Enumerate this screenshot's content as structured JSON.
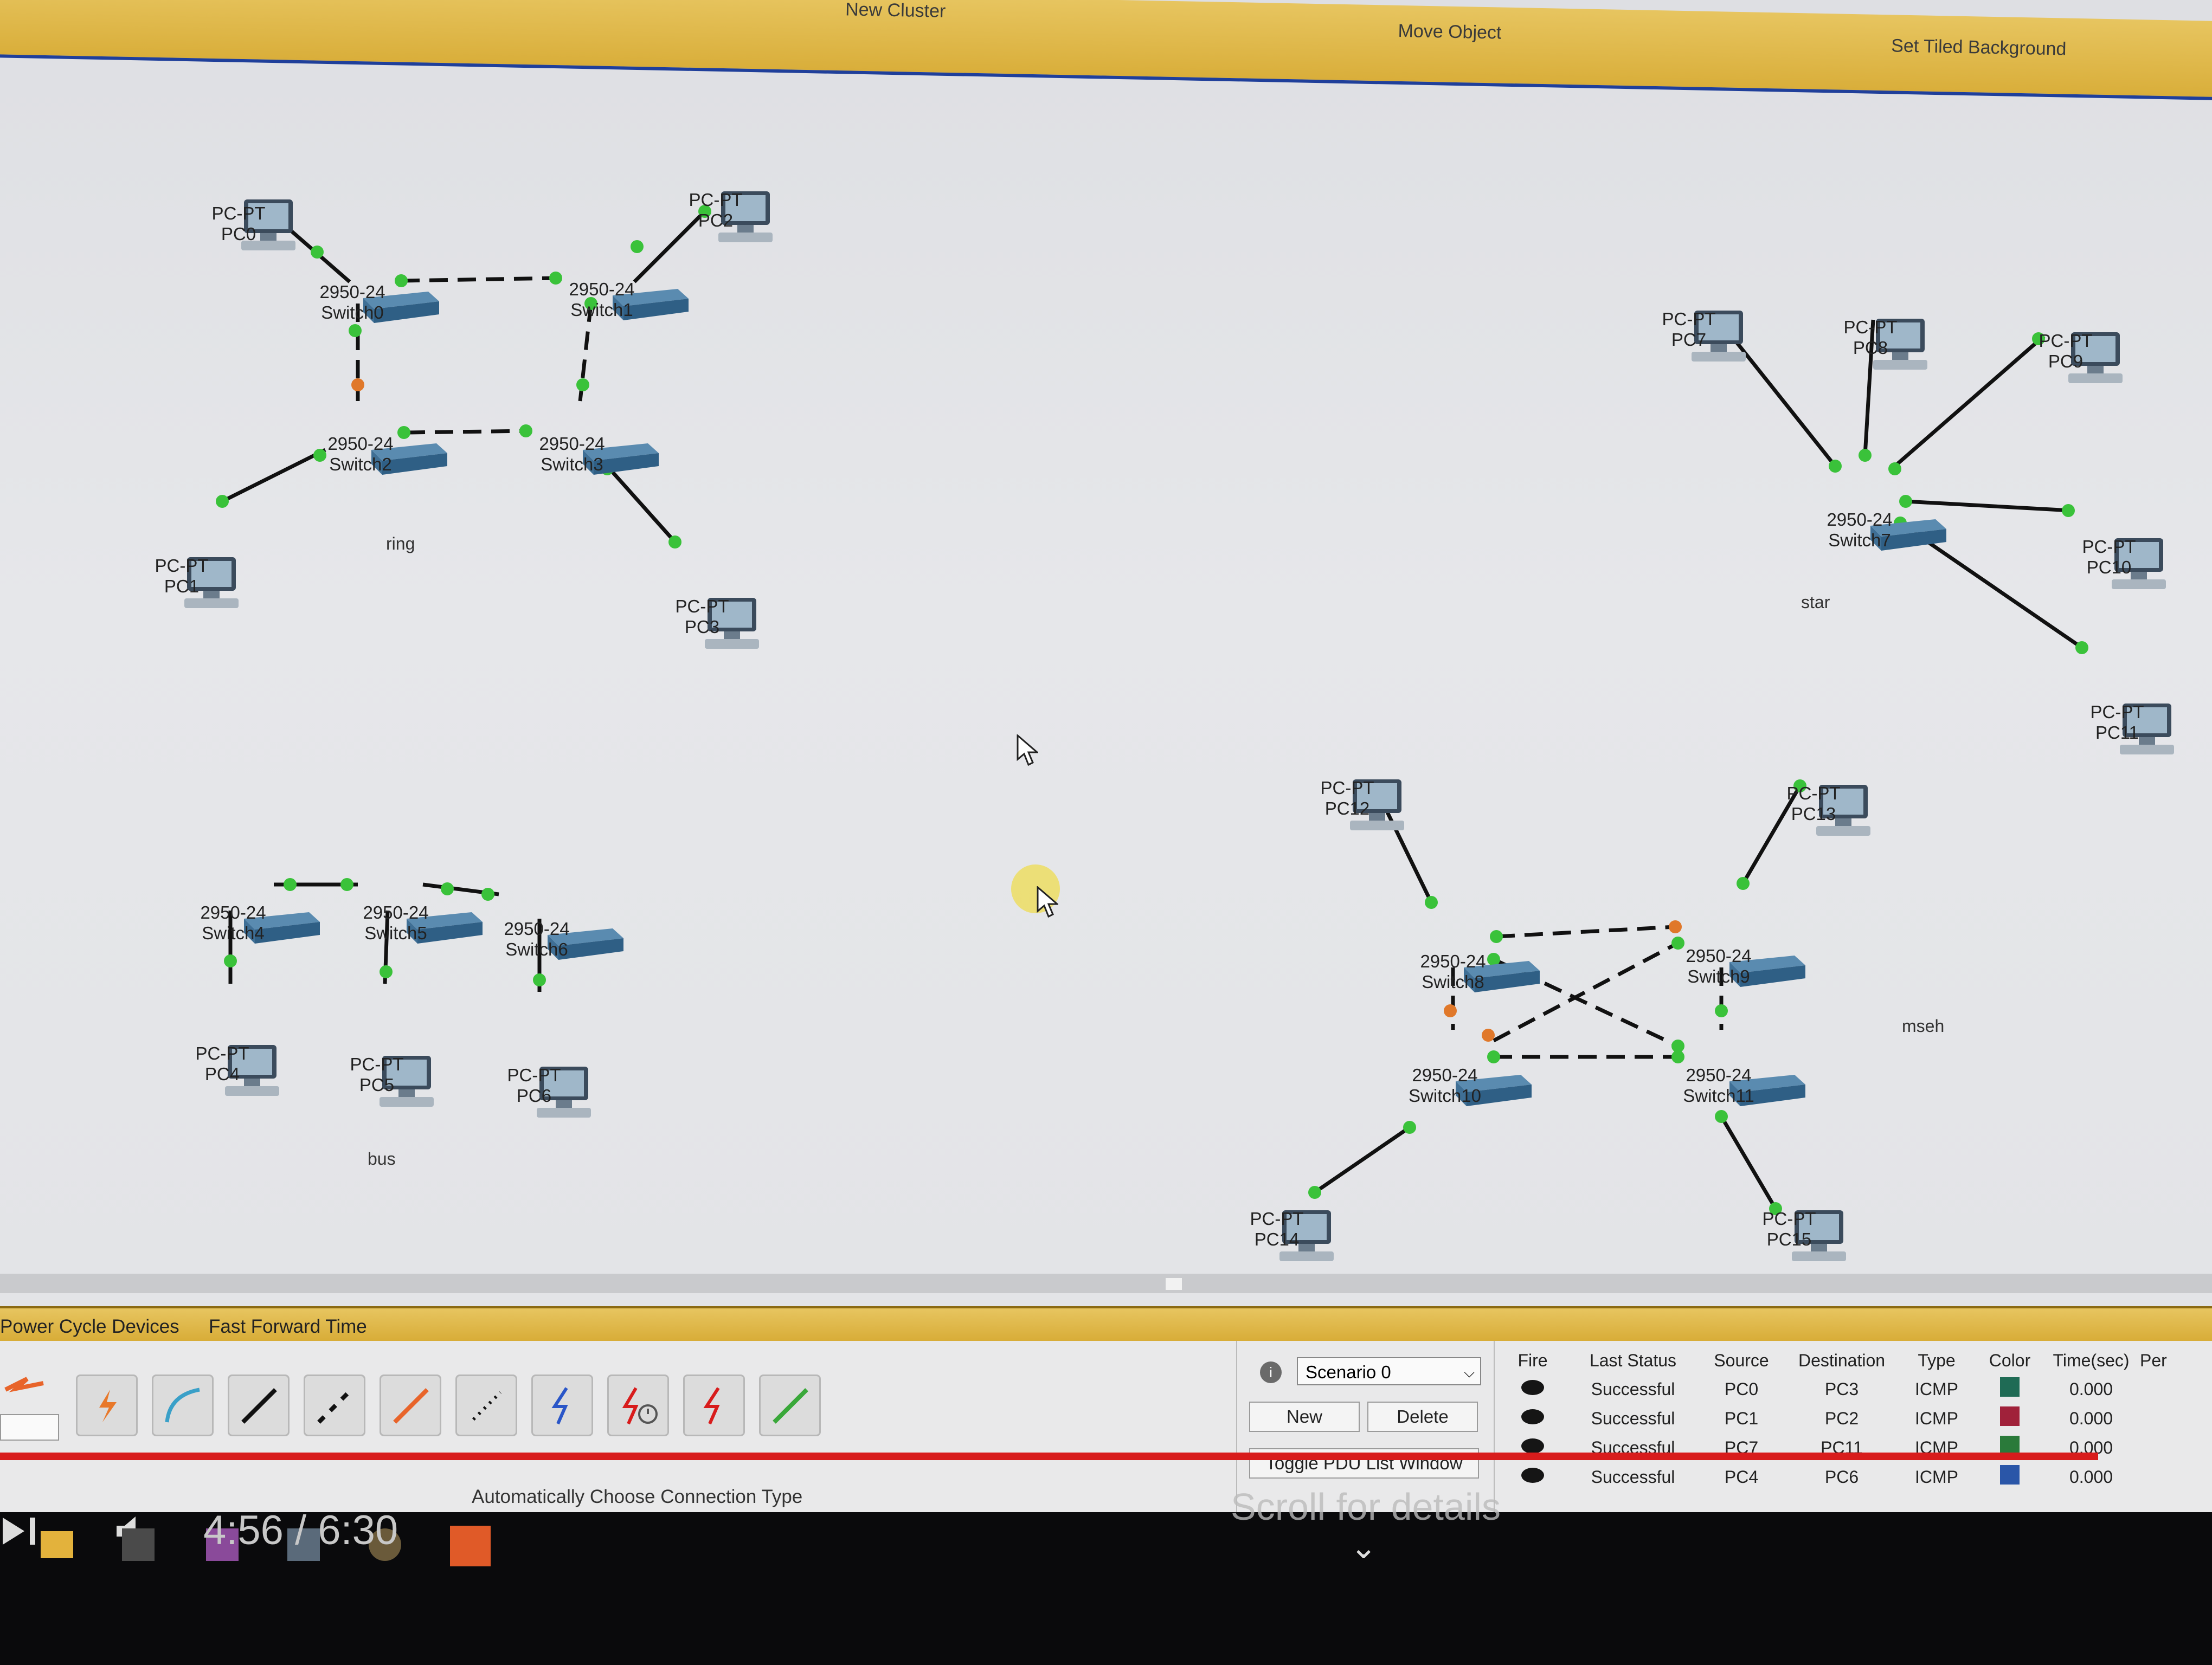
{
  "topbar": {
    "cluster": "New Cluster",
    "move": "Move Object",
    "background": "Set Tiled Background"
  },
  "groups": {
    "ring": "ring",
    "star": "star",
    "bus": "bus",
    "mesh": "mseh"
  },
  "devices": {
    "pc0": {
      "type": "PC-PT",
      "name": "PC0"
    },
    "pc1": {
      "type": "PC-PT",
      "name": "PC1"
    },
    "pc2": {
      "type": "PC-PT",
      "name": "PC2"
    },
    "pc3": {
      "type": "PC-PT",
      "name": "PC3"
    },
    "pc4": {
      "type": "PC-PT",
      "name": "PC4"
    },
    "pc5": {
      "type": "PC-PT",
      "name": "PC5"
    },
    "pc6": {
      "type": "PC-PT",
      "name": "PC6"
    },
    "pc7": {
      "type": "PC-PT",
      "name": "PC7"
    },
    "pc8": {
      "type": "PC-PT",
      "name": "PC8"
    },
    "pc9": {
      "type": "PC-PT",
      "name": "PC9"
    },
    "pc10": {
      "type": "PC-PT",
      "name": "PC10"
    },
    "pc11": {
      "type": "PC-PT",
      "name": "PC11"
    },
    "pc12": {
      "type": "PC-PT",
      "name": "PC12"
    },
    "pc13": {
      "type": "PC-PT",
      "name": "PC13"
    },
    "pc14": {
      "type": "PC-PT",
      "name": "PC14"
    },
    "pc15": {
      "type": "PC-PT",
      "name": "PC15"
    },
    "sw0": {
      "type": "2950-24",
      "name": "Switch0"
    },
    "sw1": {
      "type": "2950-24",
      "name": "Switch1"
    },
    "sw2": {
      "type": "2950-24",
      "name": "Switch2"
    },
    "sw3": {
      "type": "2950-24",
      "name": "Switch3"
    },
    "sw4": {
      "type": "2950-24",
      "name": "Switch4"
    },
    "sw5": {
      "type": "2950-24",
      "name": "Switch5"
    },
    "sw6": {
      "type": "2950-24",
      "name": "Switch6"
    },
    "sw7": {
      "type": "2950-24",
      "name": "Switch7"
    },
    "sw8": {
      "type": "2950-24",
      "name": "Switch8"
    },
    "sw9": {
      "type": "2950-24",
      "name": "Switch9"
    },
    "sw10": {
      "type": "2950-24",
      "name": "Switch10"
    },
    "sw11": {
      "type": "2950-24",
      "name": "Switch11"
    }
  },
  "bottombar": {
    "power": "Power Cycle Devices",
    "fastforward": "Fast Forward Time"
  },
  "toolbar": {
    "connection_label": "Automatically Choose Connection Type"
  },
  "scenario": {
    "selected": "Scenario 0",
    "new_label": "New",
    "delete_label": "Delete",
    "toggle_label": "Toggle PDU List Window"
  },
  "pdu": {
    "headers": [
      "Fire",
      "Last Status",
      "Source",
      "Destination",
      "Type",
      "Color",
      "Time(sec)",
      "Per"
    ],
    "rows": [
      {
        "status": "Successful",
        "source": "PC0",
        "destination": "PC3",
        "type": "ICMP",
        "color": "#1f6b55",
        "time": "0.000"
      },
      {
        "status": "Successful",
        "source": "PC1",
        "destination": "PC2",
        "type": "ICMP",
        "color": "#a0213a",
        "time": "0.000"
      },
      {
        "status": "Successful",
        "source": "PC7",
        "destination": "PC11",
        "type": "ICMP",
        "color": "#2a7a3a",
        "time": "0.000"
      },
      {
        "status": "Successful",
        "source": "PC4",
        "destination": "PC6",
        "type": "ICMP",
        "color": "#2a56a8",
        "time": "0.000"
      }
    ]
  },
  "video": {
    "time": "4:56 / 6:30",
    "hint": "Scroll for details"
  }
}
